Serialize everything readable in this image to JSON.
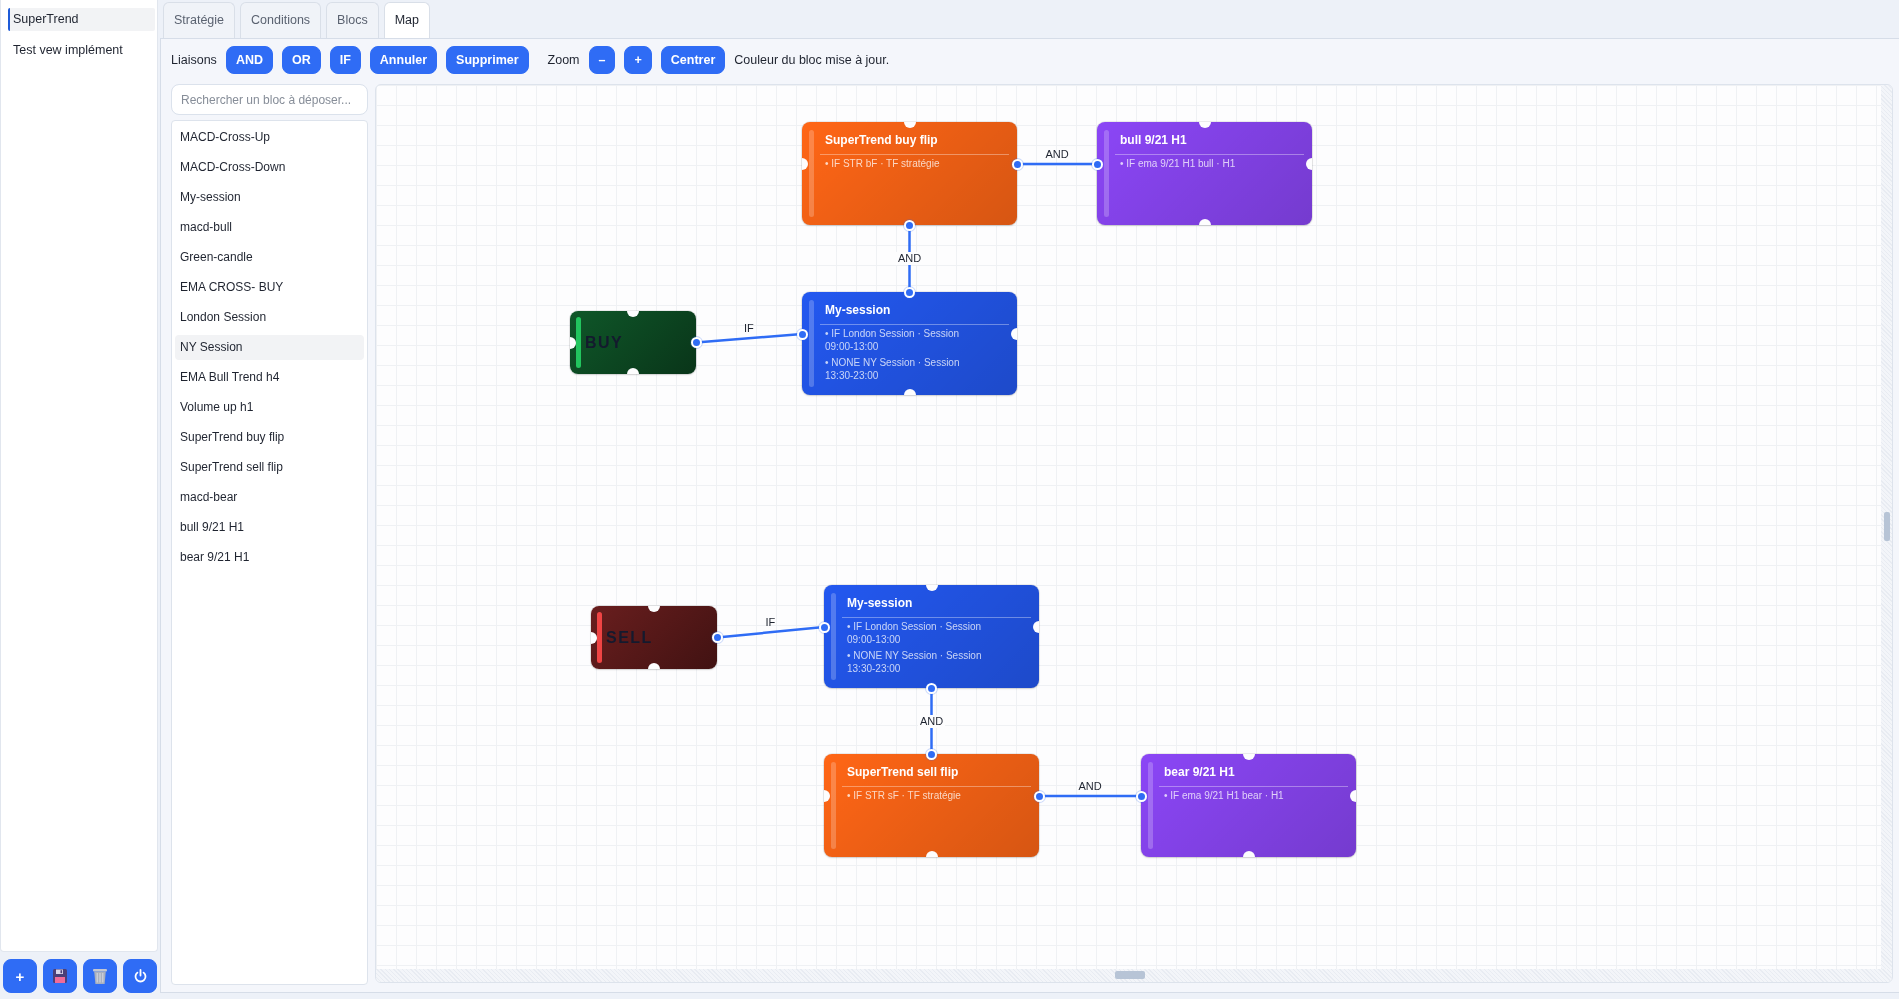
{
  "sidebar": {
    "strategies": [
      {
        "label": "SuperTrend",
        "selected": true
      },
      {
        "label": "Test vew implément",
        "selected": false
      }
    ],
    "actions": [
      {
        "kind": "add",
        "label": "+"
      },
      {
        "kind": "save"
      },
      {
        "kind": "delete"
      },
      {
        "kind": "power"
      }
    ]
  },
  "tabs": [
    {
      "label": "Stratégie",
      "selected": false
    },
    {
      "label": "Conditions",
      "selected": false
    },
    {
      "label": "Blocs",
      "selected": false
    },
    {
      "label": "Map",
      "selected": true
    }
  ],
  "toolbar": {
    "links_label": "Liaisons",
    "link_buttons": [
      "AND",
      "OR",
      "IF",
      "Annuler",
      "Supprimer"
    ],
    "zoom_label": "Zoom",
    "zoom_buttons": [
      "–",
      "+"
    ],
    "center_button": "Centrer",
    "status": "Couleur du bloc mise à jour."
  },
  "palette": {
    "search": {
      "placeholder": "Rechercher un bloc à déposer..."
    },
    "blocks": [
      {
        "label": "MACD-Cross-Up",
        "selected": false
      },
      {
        "label": "MACD-Cross-Down",
        "selected": false
      },
      {
        "label": "My-session",
        "selected": false
      },
      {
        "label": "macd-bull",
        "selected": false
      },
      {
        "label": "Green-candle",
        "selected": false
      },
      {
        "label": "EMA CROSS- BUY",
        "selected": false
      },
      {
        "label": "London Session",
        "selected": false
      },
      {
        "label": "NY Session",
        "selected": true
      },
      {
        "label": "EMA Bull Trend h4",
        "selected": false
      },
      {
        "label": "Volume up h1",
        "selected": false
      },
      {
        "label": "SuperTrend buy flip",
        "selected": false
      },
      {
        "label": "SuperTrend sell flip",
        "selected": false
      },
      {
        "label": "macd-bear",
        "selected": false
      },
      {
        "label": "bull 9/21 H1",
        "selected": false
      },
      {
        "label": "bear 9/21 H1",
        "selected": false
      }
    ]
  },
  "map": {
    "nodes": [
      {
        "kind": "block",
        "title": "SuperTrend buy flip",
        "color": "#ff6616",
        "lines": [
          "• IF STR bF · TF stratégie"
        ]
      },
      {
        "kind": "block",
        "title": "bull 9/21 H1",
        "color": "#8b46f6",
        "lines": [
          "• IF ema 9/21 H1 bull · H1"
        ]
      },
      {
        "kind": "action",
        "title": "BUY",
        "color": "#22c55e"
      },
      {
        "kind": "block",
        "title": "My-session",
        "color": "#2358f0",
        "lines": [
          "• IF London Session · Session 09:00-13:00",
          "• NONE NY Session · Session 13:30-23:00"
        ]
      },
      {
        "kind": "action",
        "title": "SELL",
        "color": "#ef4444"
      },
      {
        "kind": "block",
        "title": "My-session",
        "color": "#2358f0",
        "lines": [
          "• IF London Session · Session 09:00-13:00",
          "• NONE NY Session · Session 13:30-23:00"
        ]
      },
      {
        "kind": "block",
        "title": "SuperTrend sell flip",
        "color": "#ff6616",
        "lines": [
          "• IF STR sF · TF stratégie"
        ]
      },
      {
        "kind": "block",
        "title": "bear 9/21 H1",
        "color": "#8b46f6",
        "lines": [
          "• IF ema 9/21 H1 bear · H1"
        ]
      }
    ],
    "links": [
      {
        "label": "AND"
      },
      {
        "label": "AND"
      },
      {
        "label": "IF"
      },
      {
        "label": "IF"
      },
      {
        "label": "AND"
      },
      {
        "label": "AND"
      }
    ]
  }
}
